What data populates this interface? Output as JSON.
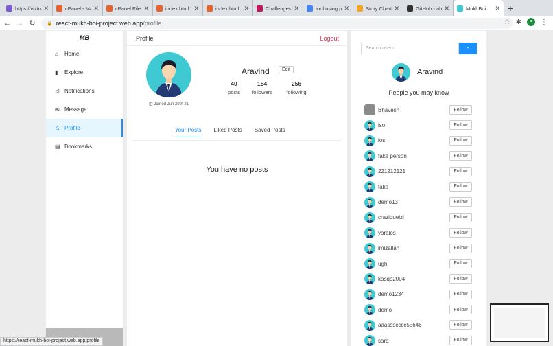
{
  "browser": {
    "tabs": [
      {
        "title": "https://vizto...",
        "color": "#7b5cd6"
      },
      {
        "title": "cPanel - Ma...",
        "color": "#e8622c"
      },
      {
        "title": "cPanel File M...",
        "color": "#e8622c"
      },
      {
        "title": "index.html",
        "color": "#e8622c"
      },
      {
        "title": "index.html",
        "color": "#e8622c"
      },
      {
        "title": "Challenges",
        "color": "#c2185b"
      },
      {
        "title": "tool using pyt...",
        "color": "#4285f4"
      },
      {
        "title": "Story Chart",
        "color": "#f4a623"
      },
      {
        "title": "GitHub - abi...",
        "color": "#333333"
      },
      {
        "title": "MukhBoi",
        "color": "#3fc9d3"
      }
    ],
    "url_host": "react-mukh-boi-project.web.app",
    "url_path": "/profile",
    "profile_initial": "S",
    "status_url": "https://react-mukh-boi-project.web.app/profile"
  },
  "sidebar": {
    "brand": "MB",
    "items": [
      {
        "label": "Home",
        "icon": "⌂"
      },
      {
        "label": "Explore",
        "icon": "▮"
      },
      {
        "label": "Notifications",
        "icon": "◁"
      },
      {
        "label": "Message",
        "icon": "✉"
      },
      {
        "label": "Profile",
        "icon": "♙"
      },
      {
        "label": "Bookmarks",
        "icon": "▤"
      }
    ]
  },
  "main": {
    "header_title": "Profile",
    "logout": "Logout",
    "joined": "Joined Jun 29th 21",
    "name": "Aravind",
    "edit": "Edit",
    "stats": {
      "posts": {
        "n": "40",
        "l": "posts"
      },
      "followers": {
        "n": "154",
        "l": "followers"
      },
      "following": {
        "n": "256",
        "l": "following"
      }
    },
    "tabs": [
      "Your Posts",
      "Liked Posts",
      "Saved Posts"
    ],
    "empty": "You have no posts"
  },
  "right": {
    "search_placeholder": "Search users ...",
    "me_name": "Aravind",
    "pymk": "People you may know",
    "follow_label": "Follow",
    "users": [
      "Bhavesh",
      "iso",
      "ios",
      "fake person",
      "221212121",
      "fake",
      "demo13",
      "crazidueizi",
      "yoralos",
      "imizallah",
      "ugh",
      "kasqo2004",
      "demo1234",
      "demo",
      "aaassscccc55646",
      "sara"
    ]
  },
  "colors": {
    "accent": "#1890ff",
    "logout": "#e8304e",
    "avatar_bg": "#3fc9d3"
  }
}
